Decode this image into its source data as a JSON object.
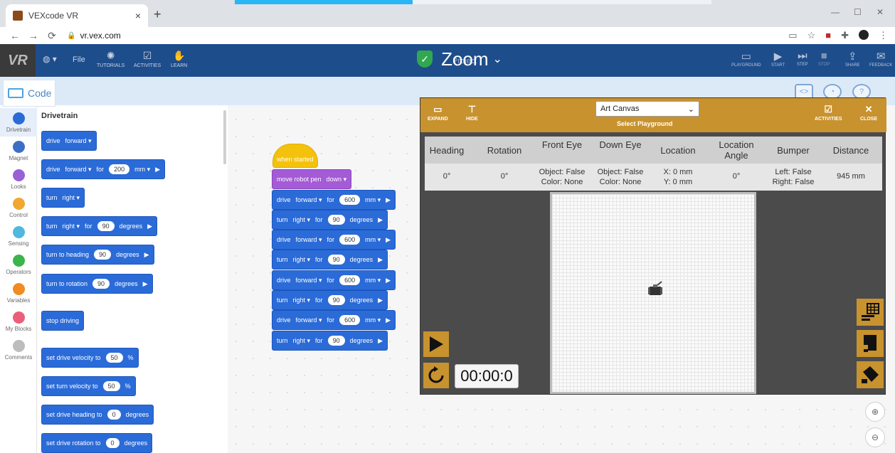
{
  "browser": {
    "tab_title": "VEXcode VR",
    "tab_close": "×",
    "new_tab": "+",
    "url": "vr.vex.com",
    "nav": {
      "back": "←",
      "forward": "→",
      "reload": "⟳"
    }
  },
  "app_header": {
    "logo": "VR",
    "file": "File",
    "tutorials": "TUTORIALS",
    "activities": "ACTIVITIES",
    "learn": "LEARN",
    "zoom_label": "Zoom",
    "project_name": "Project",
    "playground": "PLAYGROUND",
    "start": "START",
    "step": "STEP",
    "stop": "STOP",
    "share": "SHARE",
    "feedback": "FEEDBACK"
  },
  "code_tab": "Code",
  "categories": [
    {
      "label": "Drivetrain",
      "color": "#2b6bd8"
    },
    {
      "label": "Magnet",
      "color": "#3d6ec6"
    },
    {
      "label": "Looks",
      "color": "#9b5fd6"
    },
    {
      "label": "Control",
      "color": "#f0a830"
    },
    {
      "label": "Sensing",
      "color": "#4fb8dd"
    },
    {
      "label": "Operators",
      "color": "#3cb44a"
    },
    {
      "label": "Variables",
      "color": "#f08c21"
    },
    {
      "label": "My Blocks",
      "color": "#ec5f7a"
    },
    {
      "label": "Comments",
      "color": "#bdbdbd"
    }
  ],
  "palette": {
    "title": "Drivetrain",
    "blocks": [
      {
        "t1": "drive",
        "t2": "forward ▾"
      },
      {
        "t1": "drive",
        "t2": "forward ▾",
        "t3": "for",
        "v": "200",
        "t4": "mm ▾",
        "t5": "▶"
      },
      {
        "t1": "turn",
        "t2": "right ▾"
      },
      {
        "t1": "turn",
        "t2": "right ▾",
        "t3": "for",
        "v": "90",
        "t4": "degrees",
        "t5": "▶"
      },
      {
        "t1": "turn to heading",
        "v": "90",
        "t4": "degrees",
        "t5": "▶"
      },
      {
        "t1": "turn to rotation",
        "v": "90",
        "t4": "degrees",
        "t5": "▶"
      },
      {
        "t1": "stop driving"
      },
      {
        "t1": "set drive velocity to",
        "v": "50",
        "t4": "%"
      },
      {
        "t1": "set turn velocity to",
        "v": "50",
        "t4": "%"
      },
      {
        "t1": "set drive heading to",
        "v": "0",
        "t4": "degrees"
      },
      {
        "t1": "set drive rotation to",
        "v": "0",
        "t4": "degrees"
      }
    ]
  },
  "script": {
    "hat": "when started",
    "pen": {
      "t1": "move robot pen",
      "t2": "down ▾"
    },
    "steps": [
      {
        "t1": "drive",
        "t2": "forward ▾",
        "t3": "for",
        "v": "600",
        "t4": "mm ▾",
        "t5": "▶"
      },
      {
        "t1": "turn",
        "t2": "right ▾",
        "t3": "for",
        "v": "90",
        "t4": "degrees",
        "t5": "▶"
      },
      {
        "t1": "drive",
        "t2": "forward ▾",
        "t3": "for",
        "v": "600",
        "t4": "mm ▾",
        "t5": "▶"
      },
      {
        "t1": "turn",
        "t2": "right ▾",
        "t3": "for",
        "v": "90",
        "t4": "degrees",
        "t5": "▶"
      },
      {
        "t1": "drive",
        "t2": "forward ▾",
        "t3": "for",
        "v": "600",
        "t4": "mm ▾",
        "t5": "▶"
      },
      {
        "t1": "turn",
        "t2": "right ▾",
        "t3": "for",
        "v": "90",
        "t4": "degrees",
        "t5": "▶"
      },
      {
        "t1": "drive",
        "t2": "forward ▾",
        "t3": "for",
        "v": "600",
        "t4": "mm ▾",
        "t5": "▶"
      },
      {
        "t1": "turn",
        "t2": "right ▾",
        "t3": "for",
        "v": "90",
        "t4": "degrees",
        "t5": "▶"
      }
    ]
  },
  "playground": {
    "expand": "EXPAND",
    "hide": "HIDE",
    "select_value": "Art Canvas",
    "select_caption": "Select Playground",
    "activities": "ACTIVITIES",
    "close": "CLOSE",
    "headers": [
      "Heading",
      "Rotation",
      "Front Eye",
      "Down Eye",
      "Location",
      "Location Angle",
      "Bumper",
      "Distance"
    ],
    "values": {
      "heading": "0°",
      "rotation": "0°",
      "front_eye_1": "Object: False",
      "front_eye_2": "Color: None",
      "down_eye_1": "Object: False",
      "down_eye_2": "Color: None",
      "loc_x": "X: 0 mm",
      "loc_y": "Y: 0 mm",
      "location_angle": "0°",
      "bumper_left": "Left: False",
      "bumper_right": "Right: False",
      "distance": "945 mm"
    },
    "timer": "00:00:0"
  }
}
